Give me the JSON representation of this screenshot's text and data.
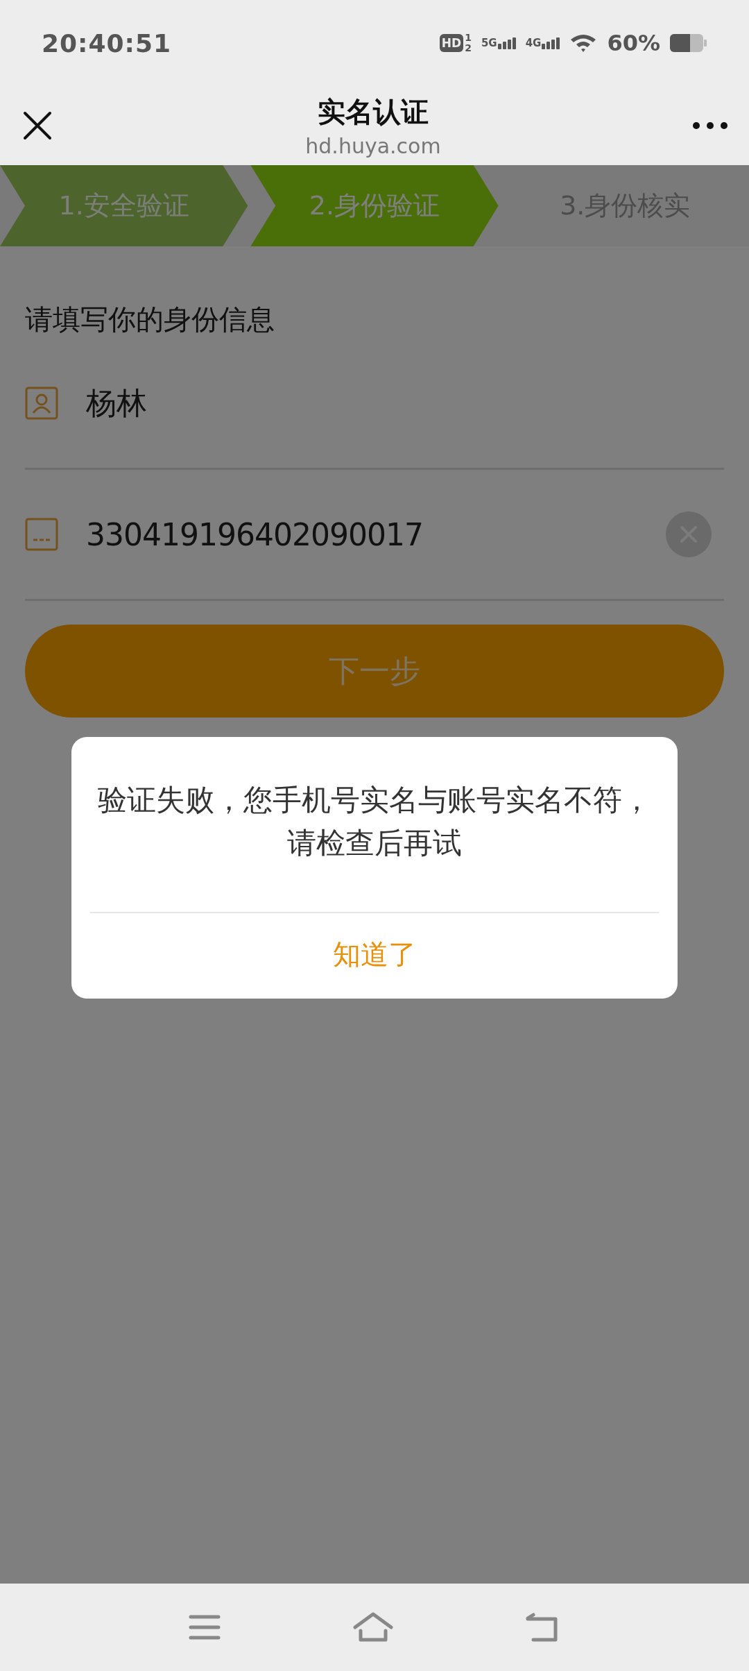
{
  "status_bar": {
    "time": "20:40:51",
    "hd_badge": {
      "label": "HD",
      "sims": [
        "1",
        "2"
      ]
    },
    "networks": [
      "5G",
      "4G"
    ],
    "battery": "60%"
  },
  "header": {
    "title": "实名认证",
    "url": "hd.huya.com"
  },
  "steps": [
    {
      "label": "1.安全验证",
      "done": true,
      "selected": false
    },
    {
      "label": "2.身份验证",
      "done": false,
      "selected": true
    },
    {
      "label": "3.身份核实",
      "done": false,
      "selected": false
    }
  ],
  "form": {
    "heading": "请填写你的身份信息",
    "fields": [
      {
        "kind": "name",
        "value": "杨林",
        "clearable": false
      },
      {
        "kind": "id",
        "value": "330419196402090017",
        "clearable": true
      }
    ],
    "submit": "下一步"
  },
  "dialog": {
    "message": "验证失败，您手机号实名与账号实名不符，请检查后再试",
    "button": "知道了"
  }
}
